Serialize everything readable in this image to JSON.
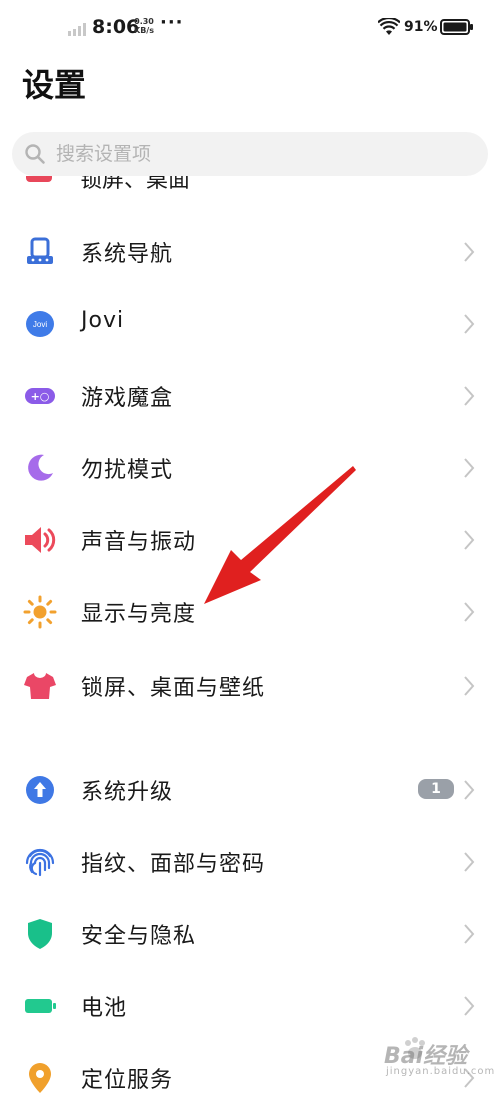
{
  "status_bar": {
    "time": "8:06",
    "net_speed_value": "0.30",
    "net_speed_unit": "KB/s",
    "more": "···",
    "battery_percent": "91%"
  },
  "page": {
    "title": "设置"
  },
  "search": {
    "placeholder": "搜索设置项"
  },
  "partial_item": {
    "label": "锁屏、桌面"
  },
  "items": [
    {
      "label": "系统导航",
      "icon": "navigation-icon",
      "color": "#3b6fd8"
    },
    {
      "label": "Jovi",
      "icon": "jovi-icon",
      "icon_text": "Jovi",
      "color": "#3f7be8"
    },
    {
      "label": "游戏魔盒",
      "icon": "gamepad-icon",
      "icon_text": "+○",
      "color": "#8b5be8"
    },
    {
      "label": "勿扰模式",
      "icon": "moon-icon",
      "color": "#a66bea"
    },
    {
      "label": "声音与振动",
      "icon": "speaker-icon",
      "color": "#ec4a5b"
    },
    {
      "label": "显示与亮度",
      "icon": "sun-icon",
      "color": "#f2a12e"
    },
    {
      "label": "锁屏、桌面与壁纸",
      "icon": "shirt-icon",
      "color": "#ea4766"
    }
  ],
  "items2": [
    {
      "label": "系统升级",
      "icon": "upgrade-icon",
      "color": "#3f78e5",
      "badge": "1"
    },
    {
      "label": "指纹、面部与密码",
      "icon": "fingerprint-icon",
      "color": "#3c72e2"
    },
    {
      "label": "安全与隐私",
      "icon": "shield-icon",
      "color": "#19c08a"
    },
    {
      "label": "电池",
      "icon": "battery-icon",
      "color": "#22c98f"
    },
    {
      "label": "定位服务",
      "icon": "location-icon",
      "color": "#f0a02c"
    }
  ],
  "watermark": {
    "text": "Bai经验",
    "sub": "jingyan.baidu.com"
  }
}
